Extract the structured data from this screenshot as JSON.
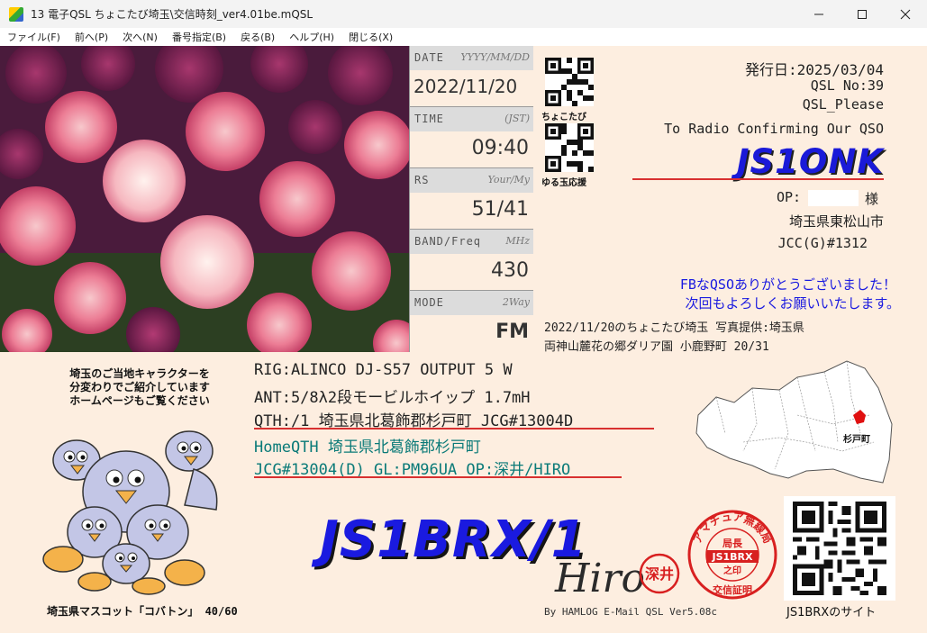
{
  "window": {
    "title": "13 電子QSL ちょこたび埼玉\\交信時刻_ver4.01be.mQSL",
    "minimize": "—",
    "maximize": "☐",
    "close": "✕"
  },
  "menu": [
    "ファイル(F)",
    "前へ(P)",
    "次へ(N)",
    "番号指定(B)",
    "戻る(B)",
    "ヘルプ(H)",
    "閉じる(X)"
  ],
  "fields": {
    "date": {
      "label": "DATE",
      "hint": "YYYY/MM/DD",
      "value": "2022/11/20"
    },
    "time": {
      "label": "TIME",
      "hint": "(JST)",
      "value": "09:40"
    },
    "rs": {
      "label": "RS",
      "hint": "Your/My",
      "value": "51/41"
    },
    "band": {
      "label": "BAND/Freq",
      "hint": "MHz",
      "value": "430"
    },
    "mode": {
      "label": "MODE",
      "hint": "2Way",
      "value": "FM"
    }
  },
  "qr": {
    "top_caption": "ちょこたび",
    "bottom_caption": "ゆる玉応援",
    "site_caption": "JS1BRXのサイト"
  },
  "issue": {
    "date_line": "発行日:2025/03/04",
    "qsl_no": "QSL No:39",
    "qsl_please": "QSL_Please",
    "confirm": "To Radio Confirming Our QSO"
  },
  "to_call": "JS1ONK",
  "op_label": "OP:",
  "op_suffix": "様",
  "to_city": "埼玉県東松山市",
  "to_jcc": "JCC(G)#1312",
  "thanks": [
    "FBなQSOありがとうございました！",
    "次回もよろしくお願いいたします。"
  ],
  "photo_credit": [
    "2022/11/20のちょこたび埼玉 写真提供:埼玉県",
    "両神山麓花の郷ダリア園 小鹿野町 20/31"
  ],
  "rig": {
    "rig": "RIG:ALINCO DJ-S57 OUTPUT 5 W",
    "ant": "ANT:5/8λ2段モービルホイップ 1.7mH",
    "qth": "QTH:/1 埼玉県北葛飾郡杉戸町 JCG#13004D"
  },
  "home": [
    "HomeQTH 埼玉県北葛飾郡杉戸町",
    "JCG#13004(D) GL:PM96UA OP:深井/HIRO"
  ],
  "mascot": {
    "intro": [
      "埼玉のご当地キャラクターを",
      "分変わりでご紹介しています",
      "ホームページもご覧ください"
    ],
    "caption": "埼玉県マスコット「コバトン」 40/60"
  },
  "my_call": "JS1BRX/1",
  "signature": "Hiro",
  "seal_name": "深井",
  "stamp": {
    "arc": "アマチュア無線局",
    "mid1": "局長",
    "mid2": "JS1BRX",
    "mid3": "之印",
    "bottom": "交信証明"
  },
  "byline": "By HAMLOG E-Mail QSL Ver5.08c",
  "map_label": "杉戸町",
  "colors": {
    "call_blue": "#1a1ad8",
    "home_teal": "#0a7a78",
    "rule_red": "#d83030",
    "card_bg": "#fdeee0"
  }
}
